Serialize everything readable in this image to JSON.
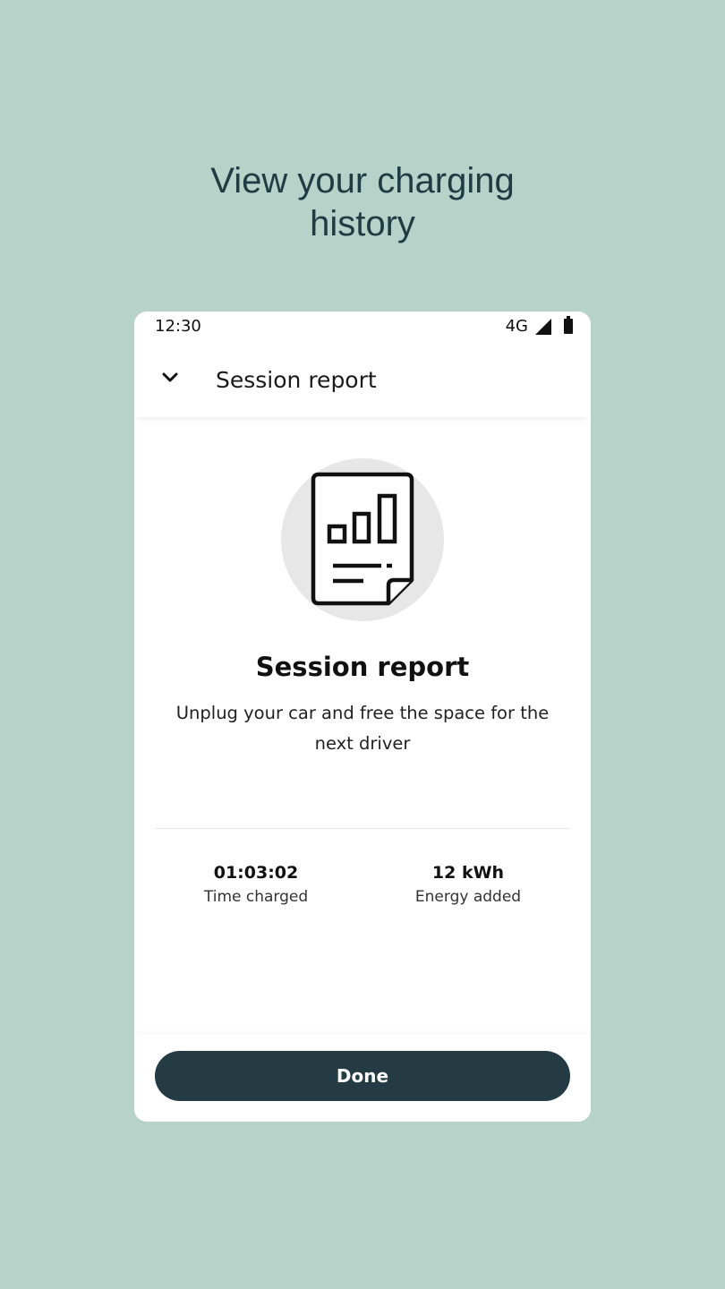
{
  "headline": {
    "line1": "View your charging",
    "line2": "history"
  },
  "status_bar": {
    "time": "12:30",
    "network": "4G",
    "icons": [
      "signal-icon",
      "battery-icon"
    ]
  },
  "app_bar": {
    "back_icon": "chevron-down-icon",
    "title": "Session report"
  },
  "illustration": {
    "icon": "report-document-icon",
    "circle_color": "#e6e7e6"
  },
  "content": {
    "title": "Session report",
    "description": "Unplug your car and free the space for the next driver"
  },
  "stats": [
    {
      "value": "01:03:02",
      "label": "Time charged"
    },
    {
      "value": "12 kWh",
      "label": "Energy added"
    }
  ],
  "footer": {
    "done_label": "Done"
  },
  "colors": {
    "background": "#b7d2c9",
    "headline_text": "#1f3b44",
    "primary_button": "#253b44"
  }
}
